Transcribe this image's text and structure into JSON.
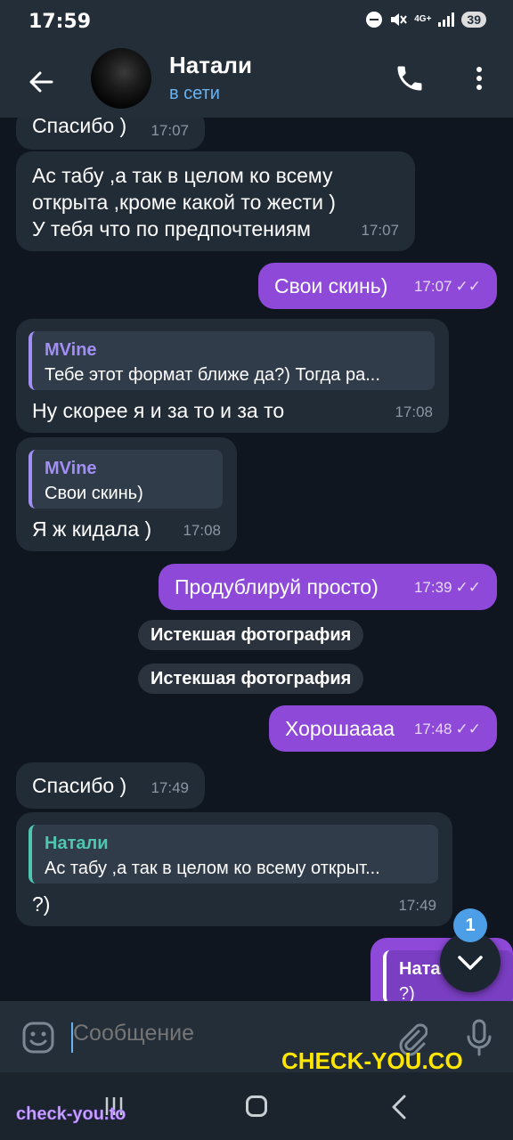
{
  "status": {
    "time": "17:59",
    "network": "4G+",
    "battery": "39"
  },
  "header": {
    "contact_name": "Натали",
    "contact_status": "в сети",
    "icons": [
      "back-arrow-icon",
      "avatar",
      "phone-icon",
      "more-vertical-icon"
    ]
  },
  "colors": {
    "outgoing_bubble": "#8e49d9",
    "incoming_bubble": "#222c37",
    "accent": "#6ab3f3",
    "reply_name": "#a18ff4",
    "reply_self": "#4fc7b0"
  },
  "messages": [
    {
      "text": "Спасибо )",
      "time": "17:07"
    },
    {
      "lines": [
        "Ас табу ,а так в целом ко всему",
        "открыта ,кроме какой то жести )",
        "У тебя что по предпочтениям"
      ],
      "time": "17:07"
    },
    {
      "text": "Свои скинь)",
      "time": "17:07"
    },
    {
      "reply_name": "MVine",
      "reply_text": "Тебе этот формат ближе да?) Тогда  ра...",
      "text": "Ну скорее я и за то и за то",
      "time": "17:08"
    },
    {
      "reply_name": "MVine",
      "reply_text": "Свои скинь)",
      "text": "Я ж кидала )",
      "time": "17:08"
    },
    {
      "text": "Продублируй просто)",
      "time": "17:39"
    },
    {
      "text": "Хорошаааа",
      "time": "17:48"
    },
    {
      "text": "Спасибо )",
      "time": "17:49"
    },
    {
      "reply_name": "Натали",
      "reply_text": "Ас табу ,а так в целом ко всему открыт...",
      "text": "?)",
      "time": "17:49"
    },
    {
      "reply_name": "Ната",
      "text": "?)"
    }
  ],
  "system": {
    "expired_photo_1": "Истекшая фотография",
    "expired_photo_2": "Истекшая фотография"
  },
  "scroll_badge": "1",
  "input": {
    "placeholder": "Сообщение"
  },
  "watermarks": {
    "main": "CHECK-YOU.CO",
    "corner": "check-you.to"
  }
}
